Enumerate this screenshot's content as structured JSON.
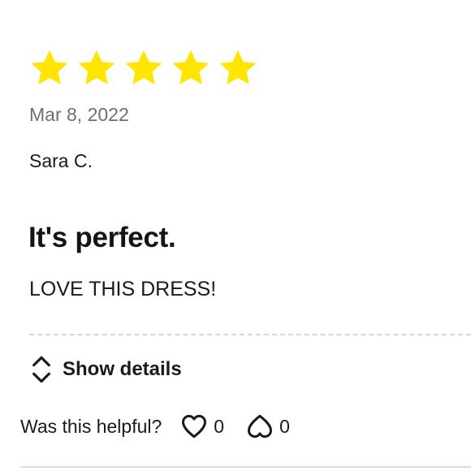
{
  "review": {
    "rating": 5,
    "rating_max": 5,
    "star_color": "#ffe500",
    "date": "Mar 8, 2022",
    "author": "Sara C.",
    "title": "It's perfect.",
    "body": "LOVE THIS DRESS!"
  },
  "details": {
    "toggle_label": "Show details",
    "icon": "chevron-up-down-icon"
  },
  "helpful": {
    "label": "Was this helpful?",
    "upvote": {
      "icon": "heart-icon",
      "count": "0"
    },
    "downvote": {
      "icon": "heart-down-icon",
      "count": "0"
    }
  }
}
